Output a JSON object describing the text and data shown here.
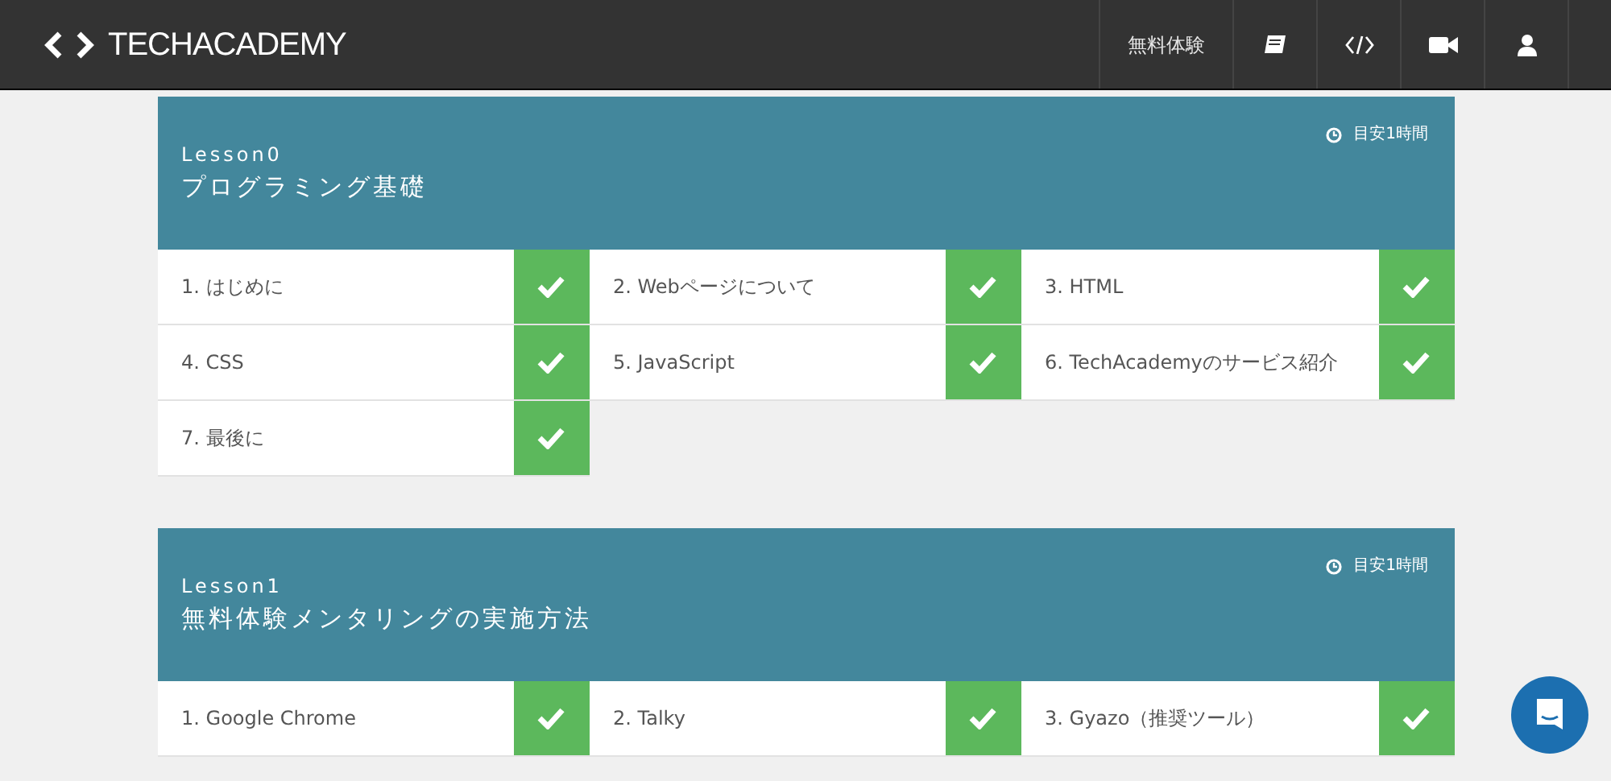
{
  "header": {
    "logo": "TECHACADEMY",
    "nav": [
      {
        "kind": "text",
        "label": "無料体験"
      },
      {
        "kind": "book"
      },
      {
        "kind": "code"
      },
      {
        "kind": "video"
      },
      {
        "kind": "user"
      }
    ]
  },
  "lessons": [
    {
      "number": "Lesson0",
      "title": "プログラミング基礎",
      "duration": "目安1時間",
      "items": [
        {
          "label": "1. はじめに",
          "completed": true
        },
        {
          "label": "2. Webページについて",
          "completed": true
        },
        {
          "label": "3. HTML",
          "completed": true
        },
        {
          "label": "4. CSS",
          "completed": true
        },
        {
          "label": "5. JavaScript",
          "completed": true
        },
        {
          "label": "6. TechAcademyのサービス紹介",
          "completed": true
        },
        {
          "label": "7. 最後に",
          "completed": true
        }
      ]
    },
    {
      "number": "Lesson1",
      "title": "無料体験メンタリングの実施方法",
      "duration": "目安1時間",
      "items": [
        {
          "label": "1. Google Chrome",
          "completed": true
        },
        {
          "label": "2. Talky",
          "completed": true
        },
        {
          "label": "3. Gyazo（推奨ツール）",
          "completed": true
        }
      ]
    }
  ]
}
